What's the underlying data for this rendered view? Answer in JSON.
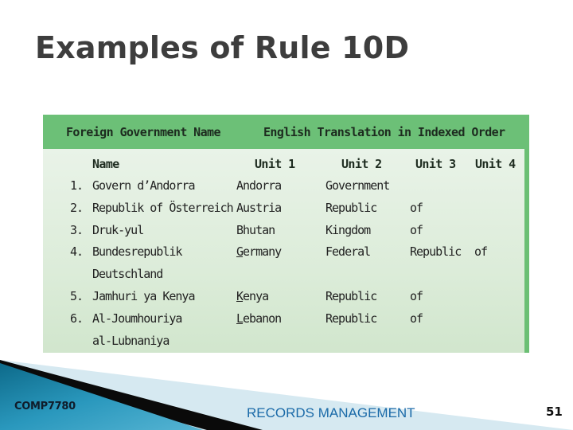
{
  "slide": {
    "title": "Examples of Rule 10D"
  },
  "table": {
    "header": {
      "left": "Foreign Government Name",
      "right": "English Translation in Indexed Order"
    },
    "columns": [
      "Name",
      "Unit 1",
      "Unit 2",
      "Unit 3",
      "Unit 4"
    ],
    "rows": [
      {
        "number": "1.",
        "name": [
          "Govern d’Andorra"
        ],
        "unit1": "Andorra",
        "unit2": "Government",
        "unit3": "",
        "unit4": "",
        "underline_unit1": false
      },
      {
        "number": "2.",
        "name": [
          "Republik of Österreich"
        ],
        "unit1": "Austria",
        "unit2": "Republic",
        "unit3": "of",
        "unit4": "",
        "underline_unit1": false
      },
      {
        "number": "3.",
        "name": [
          "Druk-yul"
        ],
        "unit1": "Bhutan",
        "unit2": "Kingdom",
        "unit3": "of",
        "unit4": "",
        "underline_unit1": false
      },
      {
        "number": "4.",
        "name": [
          "Bundesrepublik",
          "Deutschland"
        ],
        "unit1": "Germany",
        "unit2": "Federal",
        "unit3": "Republic",
        "unit4": "of",
        "underline_unit1": true
      },
      {
        "number": "5.",
        "name": [
          "Jamhuri ya Kenya"
        ],
        "unit1": "Kenya",
        "unit2": "Republic",
        "unit3": "of",
        "unit4": "",
        "underline_unit1": true
      },
      {
        "number": "6.",
        "name": [
          "Al-Joumhouriya",
          "al-Lubnaniya"
        ],
        "unit1": "Lebanon",
        "unit2": "Republic",
        "unit3": "of",
        "unit4": "",
        "underline_unit1": true
      }
    ]
  },
  "footer": {
    "course_code": "COMP7780",
    "course_name": "RECORDS MANAGEMENT",
    "page_number": "51"
  },
  "colors": {
    "header_green": "#6cc077",
    "body_green_top": "#e9f3e8",
    "body_green_bottom": "#d1e6cd",
    "footer_text_blue": "#1a6aa8",
    "footer_teal": "#1b7fa0"
  }
}
